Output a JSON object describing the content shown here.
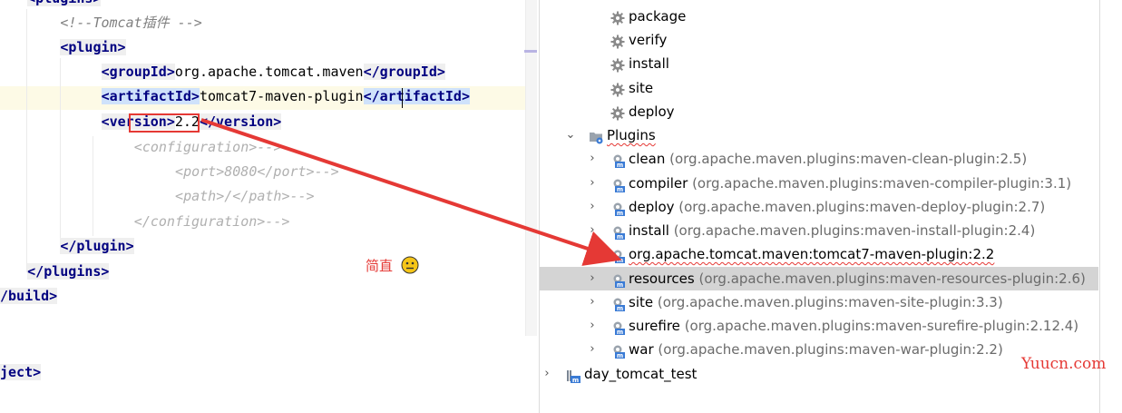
{
  "editor": {
    "lines": [
      {
        "indent": 3,
        "parts": [
          [
            "t",
            "<plugins>"
          ]
        ]
      },
      {
        "indent": 7,
        "parts": [
          [
            "cm",
            "<!--Tomcat插件 -->"
          ]
        ]
      },
      {
        "indent": 7,
        "parts": [
          [
            "t",
            "<plugin>"
          ]
        ]
      },
      {
        "indent": 12,
        "parts": [
          [
            "t",
            "<groupId>"
          ],
          [
            "val",
            "org.apache.tomcat.maven"
          ],
          [
            "t",
            "</groupId>"
          ]
        ]
      },
      {
        "indent": 12,
        "parts": [
          [
            "t-sel",
            "<artifactId>"
          ],
          [
            "val",
            "tomcat7-maven-plugin"
          ],
          [
            "t-sel",
            "</artifactId>"
          ]
        ]
      },
      {
        "indent": 12,
        "parts": [
          [
            "t",
            "<version>"
          ],
          [
            "val",
            "2.2"
          ],
          [
            "t",
            "</version>"
          ]
        ]
      },
      {
        "indent": 16,
        "parts": [
          [
            "cm-t",
            "<configuration>-->"
          ]
        ]
      },
      {
        "indent": 21,
        "parts": [
          [
            "cm-t",
            "<port>8080</port>-->"
          ]
        ]
      },
      {
        "indent": 21,
        "parts": [
          [
            "cm-t",
            "<path>/</path>-->"
          ]
        ]
      },
      {
        "indent": 16,
        "parts": [
          [
            "cm-t",
            "</configuration>-->"
          ]
        ]
      },
      {
        "indent": 7,
        "parts": [
          [
            "t",
            "</plugin>"
          ]
        ]
      },
      {
        "indent": 3,
        "parts": [
          [
            "t",
            "</plugins>"
          ]
        ]
      },
      {
        "indent": 0,
        "parts": [
          [
            "t",
            "/build>"
          ]
        ]
      },
      {
        "indent": 0,
        "parts": [
          [
            "val",
            ""
          ]
        ]
      },
      {
        "indent": 0,
        "parts": [
          [
            "t",
            "ject>"
          ]
        ]
      }
    ]
  },
  "tree": {
    "lifecycle": [
      "package",
      "verify",
      "install",
      "site",
      "deploy"
    ],
    "plugins_label": "Plugins",
    "plugins": [
      {
        "name": "clean",
        "coord": "(org.apache.maven.plugins:maven-clean-plugin:2.5)"
      },
      {
        "name": "compiler",
        "coord": "(org.apache.maven.plugins:maven-compiler-plugin:3.1)"
      },
      {
        "name": "deploy",
        "coord": "(org.apache.maven.plugins:maven-deploy-plugin:2.7)"
      },
      {
        "name": "install",
        "coord": "(org.apache.maven.plugins:maven-install-plugin:2.4)"
      },
      {
        "name": "org.apache.tomcat.maven:tomcat7-maven-plugin:2.2",
        "coord": ""
      },
      {
        "name": "resources",
        "coord": "(org.apache.maven.plugins:maven-resources-plugin:2.6)"
      },
      {
        "name": "site",
        "coord": "(org.apache.maven.plugins:maven-site-plugin:3.3)"
      },
      {
        "name": "surefire",
        "coord": "(org.apache.maven.plugins:maven-surefire-plugin:2.12.4)"
      },
      {
        "name": "war",
        "coord": "(org.apache.maven.plugins:maven-war-plugin:2.2)"
      }
    ],
    "project": "day_tomcat_test",
    "selected_plugin": "resources"
  },
  "annotation": {
    "note": "简直",
    "watermark": "Yuucn.com",
    "color": "#e53935"
  },
  "icons": {
    "lifecycle": "gear-icon",
    "plugins_folder": "plugins-folder-icon",
    "plugin": "maven-plugin-icon",
    "project": "maven-project-icon",
    "emoji": "neutral-face-icon"
  }
}
